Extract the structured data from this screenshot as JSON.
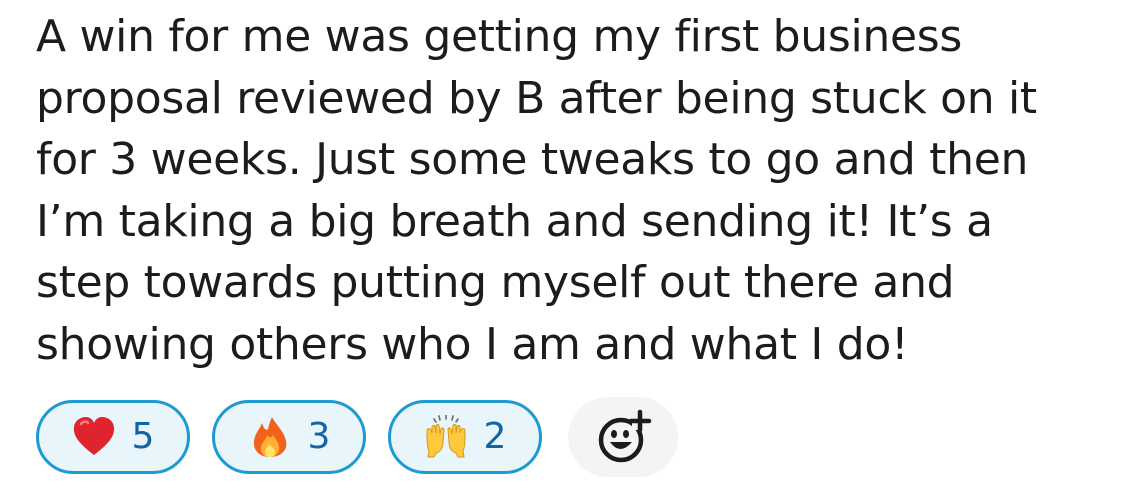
{
  "message": {
    "lines": [
      "A win for me was getting my first business",
      "proposal reviewed by B after being stuck on it",
      "for 3 weeks. Just some tweaks to go and then",
      "I’m taking a big breath and sending it!  It’s a",
      "step towards putting myself out there and",
      "showing others who I am and what I do!"
    ]
  },
  "reactions": [
    {
      "icon": "red-heart-icon",
      "count": "5"
    },
    {
      "icon": "fire-icon",
      "count": "3"
    },
    {
      "icon": "raising-hands-icon",
      "count": "2"
    }
  ],
  "add_reaction": {
    "icon": "add-emoji-reaction-icon"
  },
  "colors": {
    "reaction_border": "#1d9bd1",
    "reaction_background": "#e8f5fa",
    "reaction_count": "#1264a3",
    "add_reaction_background": "#f4f4f4",
    "text": "#1d1c1d"
  }
}
